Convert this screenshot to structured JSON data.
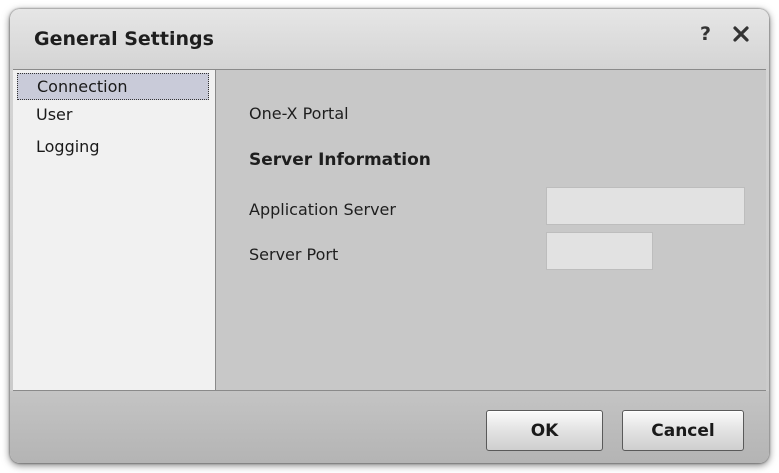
{
  "dialog": {
    "title": "General Settings",
    "help_icon": "?",
    "close_icon": "close-x"
  },
  "sidebar": {
    "items": [
      {
        "label": "Connection",
        "selected": true
      },
      {
        "label": "User",
        "selected": false
      },
      {
        "label": "Logging",
        "selected": false
      }
    ]
  },
  "main": {
    "heading": "One-X Portal",
    "section_title": "Server Information",
    "application_server": {
      "label": "Application Server",
      "value": ""
    },
    "server_port": {
      "label": "Server Port",
      "value": ""
    }
  },
  "footer": {
    "ok_label": "OK",
    "cancel_label": "Cancel"
  },
  "colors": {
    "selection": "#c9cbd9",
    "panel": "#c8c8c8",
    "sidebar": "#f1f1f1"
  }
}
